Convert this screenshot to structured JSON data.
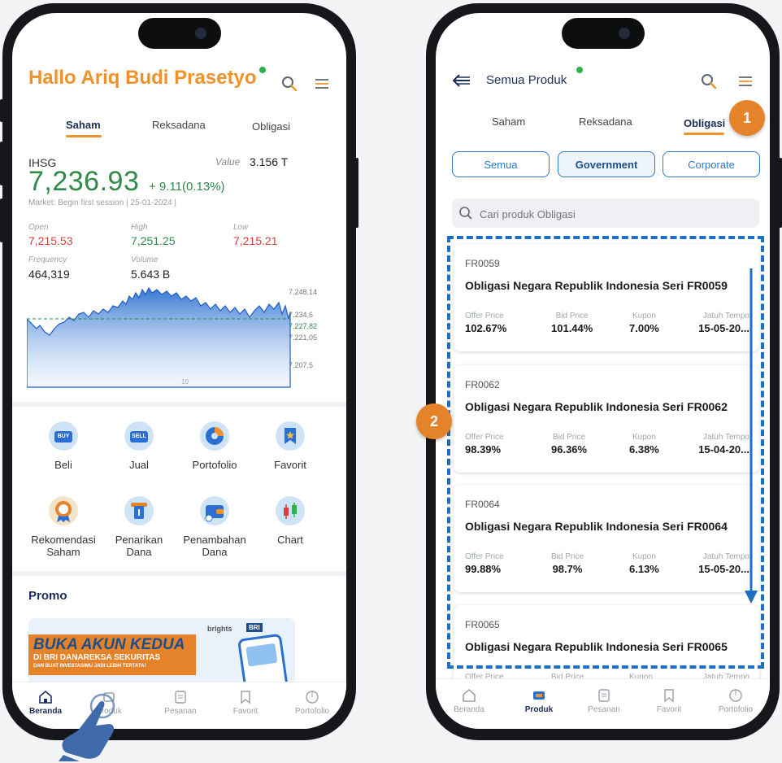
{
  "left": {
    "greeting": "Hallo Ariq Budi Prasetyo",
    "tabs": [
      "Saham",
      "Reksadana",
      "Obligasi"
    ],
    "index_name": "IHSG",
    "value_label": "Value",
    "value_amount": "3.156 T",
    "index_price": "7,236.93",
    "index_change": "+ 9.11(0.13%)",
    "market_status": "Market: Begin first session | 25-01-2024 |",
    "stats": {
      "open_label": "Open",
      "open_value": "7,215.53",
      "high_label": "High",
      "high_value": "7,251.25",
      "low_label": "Low",
      "low_value": "7,215.21",
      "frequency_label": "Frequency",
      "frequency_value": "464,319",
      "volume_label": "Volume",
      "volume_value": "5.643 B"
    },
    "chart_ticks": [
      "7.248,14",
      "7.234,6",
      "7.227,82",
      "7.221,05",
      "7.207,5"
    ],
    "chart_x_label": "10",
    "features": [
      "Beli",
      "Jual",
      "Portofolio",
      "Favorit",
      "Rekomendasi Saham",
      "Penarikan Dana",
      "Penambahan Dana",
      "Chart"
    ],
    "buy_badge": "BUY",
    "sell_badge": "SELL",
    "promo_title": "Promo",
    "promo_brand": "brights",
    "promo_bank": "BRI",
    "promo_headline": "BUKA AKUN KEDUA",
    "promo_sub1": "DI BRI DANAREKSA SEKURITAS",
    "promo_sub2": "DAN BUAT INVESTASIMU JADI LEBIH TERTATA!",
    "nav": [
      "Beranda",
      "Produk",
      "Pesanan",
      "Favorit",
      "Portofolio"
    ]
  },
  "right": {
    "title": "Semua Produk",
    "tabs": [
      "Saham",
      "Reksadana",
      "Obligasi"
    ],
    "chips": [
      "Semua",
      "Government",
      "Corporate"
    ],
    "search_placeholder": "Cari produk Obligasi",
    "col_headers": [
      "Offer Price",
      "Bid Price",
      "Kupon",
      "Jatuh Tempo"
    ],
    "products": [
      {
        "code": "FR0059",
        "name": "Obligasi Negara Republik Indonesia Seri FR0059",
        "offer": "102.67%",
        "bid": "101.44%",
        "kupon": "7.00%",
        "tempo": "15-05-20..."
      },
      {
        "code": "FR0062",
        "name": "Obligasi Negara Republik Indonesia Seri FR0062",
        "offer": "98.39%",
        "bid": "96.36%",
        "kupon": "6.38%",
        "tempo": "15-04-20..."
      },
      {
        "code": "FR0064",
        "name": "Obligasi Negara Republik Indonesia Seri FR0064",
        "offer": "99.88%",
        "bid": "98.7%",
        "kupon": "6.13%",
        "tempo": "15-05-20..."
      },
      {
        "code": "FR0065",
        "name": "Obligasi Negara Republik Indonesia Seri FR0065",
        "offer": "",
        "bid": "",
        "kupon": "",
        "tempo": ""
      }
    ],
    "nav": [
      "Beranda",
      "Produk",
      "Pesanan",
      "Favorit",
      "Portofolio"
    ]
  },
  "annotations": {
    "step1": "1",
    "step2": "2"
  },
  "colors": {
    "brand_orange": "#f0922b",
    "brand_blue": "#2f78c4",
    "navy": "#1a2e5a",
    "up_green": "#2f8a4a",
    "down_red": "#d6423a",
    "annotation_orange": "#e5832a"
  }
}
